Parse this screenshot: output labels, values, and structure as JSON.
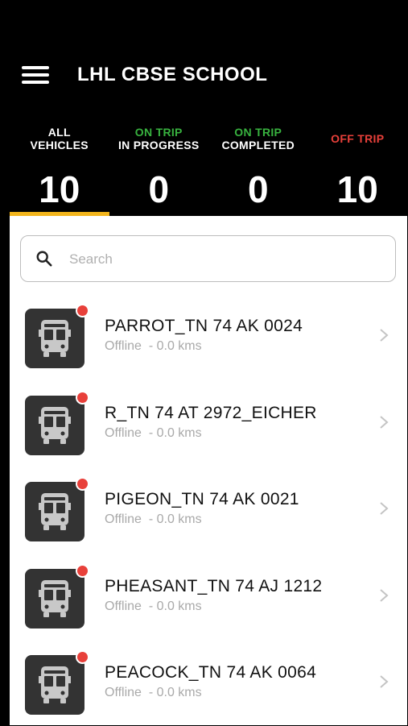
{
  "header": {
    "title": "LHL CBSE SCHOOL"
  },
  "tabs": [
    {
      "line1": "ALL",
      "line2": "VEHICLES",
      "count": "10",
      "color": "#ffffff",
      "active": true
    },
    {
      "line1": "ON TRIP",
      "line2": "IN PROGRESS",
      "count": "0",
      "color": "#38b23f"
    },
    {
      "line1": "ON TRIP",
      "line2": "COMPLETED",
      "count": "0",
      "color": "#38b23f"
    },
    {
      "line1": "OFF TRIP",
      "line2": "",
      "count": "10",
      "color": "#e8403a"
    }
  ],
  "search": {
    "placeholder": "Search"
  },
  "vehicles": [
    {
      "name": "PARROT_TN 74 AK 0024",
      "status": "Offline",
      "distance": "- 0.0 kms"
    },
    {
      "name": "R_TN 74 AT 2972_EICHER",
      "status": "Offline",
      "distance": "- 0.0 kms"
    },
    {
      "name": "PIGEON_TN 74 AK 0021",
      "status": "Offline",
      "distance": "- 0.0 kms"
    },
    {
      "name": "PHEASANT_TN 74 AJ 1212",
      "status": "Offline",
      "distance": "- 0.0 kms"
    },
    {
      "name": "PEACOCK_TN 74 AK 0064",
      "status": "Offline",
      "distance": "- 0.0 kms"
    }
  ],
  "colors": {
    "accent": "#f3b51c",
    "offline_dot": "#e8403a",
    "header_bg": "#000000"
  }
}
